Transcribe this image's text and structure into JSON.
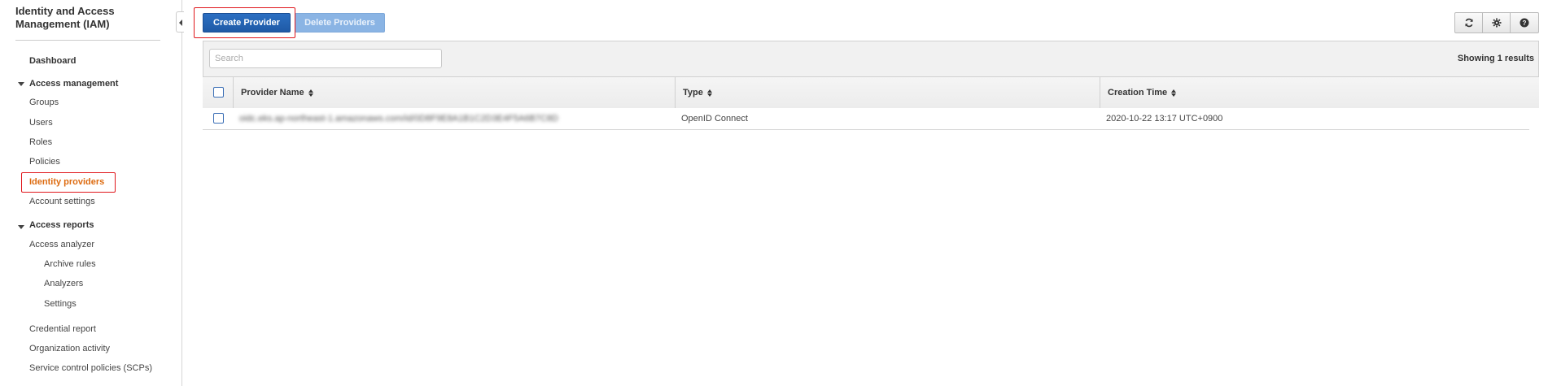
{
  "sidebar": {
    "title": "Identity and Access Management (IAM)",
    "dashboard": "Dashboard",
    "access_management": {
      "label": "Access management",
      "items": [
        "Groups",
        "Users",
        "Roles",
        "Policies",
        "Identity providers",
        "Account settings"
      ]
    },
    "access_reports": {
      "label": "Access reports",
      "items": [
        "Access analyzer"
      ],
      "analyzer_subitems": [
        "Archive rules",
        "Analyzers",
        "Settings"
      ],
      "more_items": [
        "Credential report",
        "Organization activity",
        "Service control policies (SCPs)"
      ]
    },
    "active_item": "Identity providers"
  },
  "toolbar": {
    "create_label": "Create Provider",
    "delete_label": "Delete Providers",
    "icons": [
      "refresh-icon",
      "gear-icon",
      "help-icon"
    ]
  },
  "search": {
    "placeholder": "Search",
    "value": ""
  },
  "results_text": "Showing 1 results",
  "table": {
    "columns": [
      "Provider Name",
      "Type",
      "Creation Time"
    ],
    "rows": [
      {
        "provider_name": "oidc.eks.ap-northeast-1.amazonaws.com/id/0D8F9E8A1B1C2D3E4F5A6B7C8D",
        "type": "OpenID Connect",
        "creation_time": "2020-10-22 13:17 UTC+0900"
      }
    ]
  },
  "colors": {
    "primary": "#1f5aa6",
    "active_nav": "#dd6b10",
    "highlight_box": "#e0161b"
  }
}
